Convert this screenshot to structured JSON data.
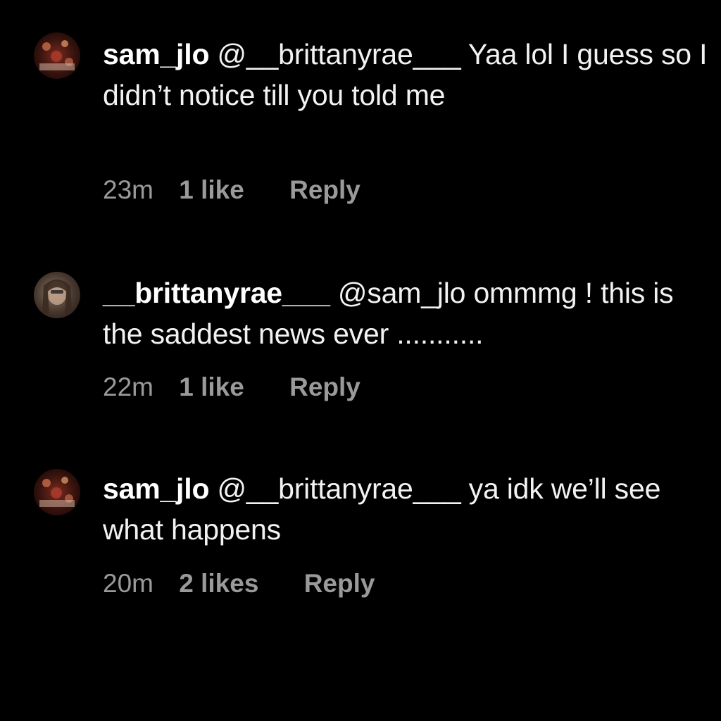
{
  "comments": [
    {
      "username": "sam_jlo",
      "mention": "@__brittanyrae___",
      "text": "Yaa lol I guess so I didn’t notice till you told me",
      "time": "23m",
      "likes": "1 like",
      "reply_label": "Reply"
    },
    {
      "username": "__brittanyrae___",
      "mention": "@sam_jlo",
      "text": "ommmg ! this is the saddest news ever ...........",
      "time": "22m",
      "likes": "1 like",
      "reply_label": "Reply"
    },
    {
      "username": "sam_jlo",
      "mention": "@__brittanyrae___",
      "text": "ya idk we’ll see what happens",
      "time": "20m",
      "likes": "2 likes",
      "reply_label": "Reply"
    }
  ],
  "colors": {
    "background": "#000000",
    "text": "#f2f2f2",
    "meta": "#9a9a9a"
  }
}
